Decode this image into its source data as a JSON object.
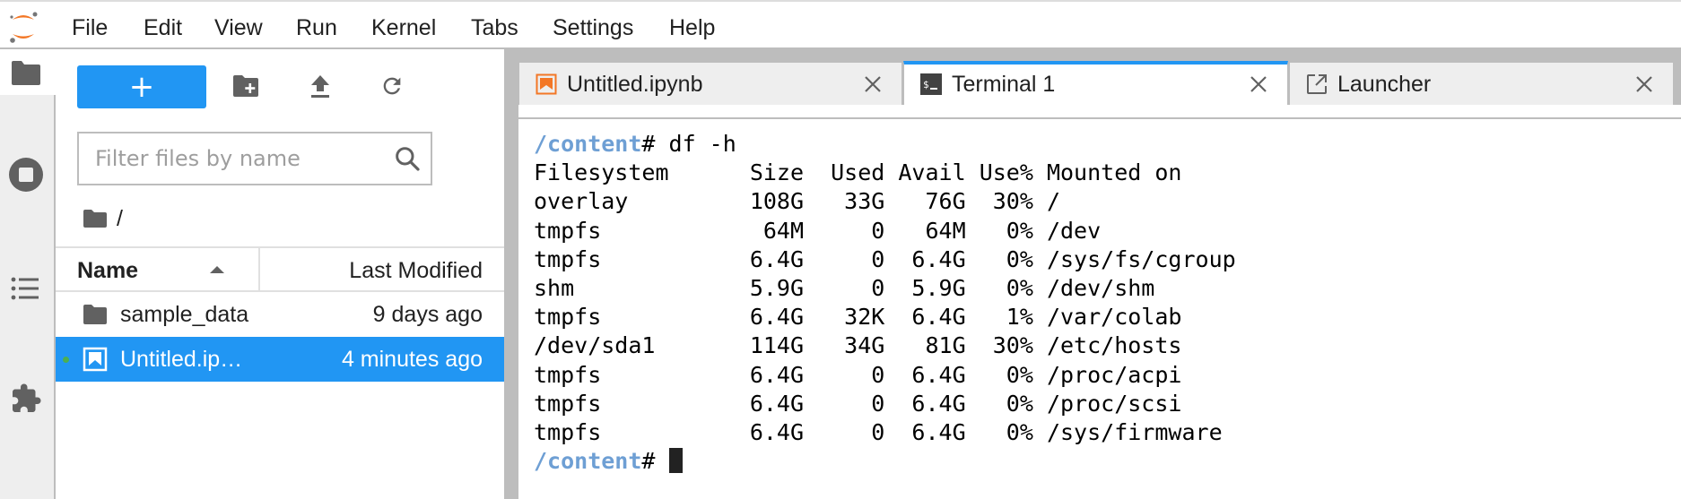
{
  "menubar": {
    "logo": "jupyter-logo",
    "items": [
      "File",
      "Edit",
      "View",
      "Run",
      "Kernel",
      "Tabs",
      "Settings",
      "Help"
    ]
  },
  "activity_bar": {
    "items": [
      {
        "icon": "folder-icon",
        "label": "File Browser",
        "active": true
      },
      {
        "icon": "running-stop-icon",
        "label": "Running Terminals and Kernels",
        "active": false
      },
      {
        "icon": "list-icon",
        "label": "Table of Contents",
        "active": false
      },
      {
        "icon": "puzzle-icon",
        "label": "Extension Manager",
        "active": false
      }
    ]
  },
  "filebrowser": {
    "new_button_label": "+",
    "toolbar": [
      "new-folder-icon",
      "upload-icon",
      "refresh-icon"
    ],
    "filter_placeholder": "Filter files by name",
    "filter_value": "",
    "breadcrumb": "/",
    "columns": {
      "name": "Name",
      "modified": "Last Modified"
    },
    "files": [
      {
        "name": "sample_data",
        "type": "folder",
        "modified": "9 days ago",
        "selected": false,
        "running": false
      },
      {
        "name": "Untitled.ip…",
        "type": "notebook",
        "modified": "4 minutes ago",
        "selected": true,
        "running": true
      }
    ]
  },
  "tabs": [
    {
      "label": "Untitled.ipynb",
      "icon": "notebook-icon",
      "active": false
    },
    {
      "label": "Terminal 1",
      "icon": "terminal-icon",
      "active": true
    },
    {
      "label": "Launcher",
      "icon": "launcher-icon",
      "active": false
    }
  ],
  "terminal": {
    "prompt_path": "/content",
    "prompt_symbol": "# ",
    "command": "df -h",
    "header": "Filesystem      Size  Used Avail Use% Mounted on",
    "rows": [
      "overlay         108G   33G   76G  30% /",
      "tmpfs            64M     0   64M   0% /dev",
      "tmpfs           6.4G     0  6.4G   0% /sys/fs/cgroup",
      "shm             5.9G     0  5.9G   0% /dev/shm",
      "tmpfs           6.4G   32K  6.4G   1% /var/colab",
      "/dev/sda1       114G   34G   81G  30% /etc/hosts",
      "tmpfs           6.4G     0  6.4G   0% /proc/acpi",
      "tmpfs           6.4G     0  6.4G   0% /proc/scsi",
      "tmpfs           6.4G     0  6.4G   0% /sys/firmware"
    ],
    "df_table": {
      "columns": [
        "Filesystem",
        "Size",
        "Used",
        "Avail",
        "Use%",
        "Mounted on"
      ],
      "data": [
        [
          "overlay",
          "108G",
          "33G",
          "76G",
          "30%",
          "/"
        ],
        [
          "tmpfs",
          "64M",
          "0",
          "64M",
          "0%",
          "/dev"
        ],
        [
          "tmpfs",
          "6.4G",
          "0",
          "6.4G",
          "0%",
          "/sys/fs/cgroup"
        ],
        [
          "shm",
          "5.9G",
          "0",
          "5.9G",
          "0%",
          "/dev/shm"
        ],
        [
          "tmpfs",
          "6.4G",
          "32K",
          "6.4G",
          "1%",
          "/var/colab"
        ],
        [
          "/dev/sda1",
          "114G",
          "34G",
          "81G",
          "30%",
          "/etc/hosts"
        ],
        [
          "tmpfs",
          "6.4G",
          "0",
          "6.4G",
          "0%",
          "/proc/acpi"
        ],
        [
          "tmpfs",
          "6.4G",
          "0",
          "6.4G",
          "0%",
          "/proc/scsi"
        ],
        [
          "tmpfs",
          "6.4G",
          "0",
          "6.4G",
          "0%",
          "/sys/firmware"
        ]
      ]
    }
  },
  "colors": {
    "accent": "#2196f3",
    "jupyter_orange": "#f37726",
    "prompt_path": "#6e9fd4",
    "icon_gray": "#616161",
    "running_dot": "#4caf50"
  }
}
